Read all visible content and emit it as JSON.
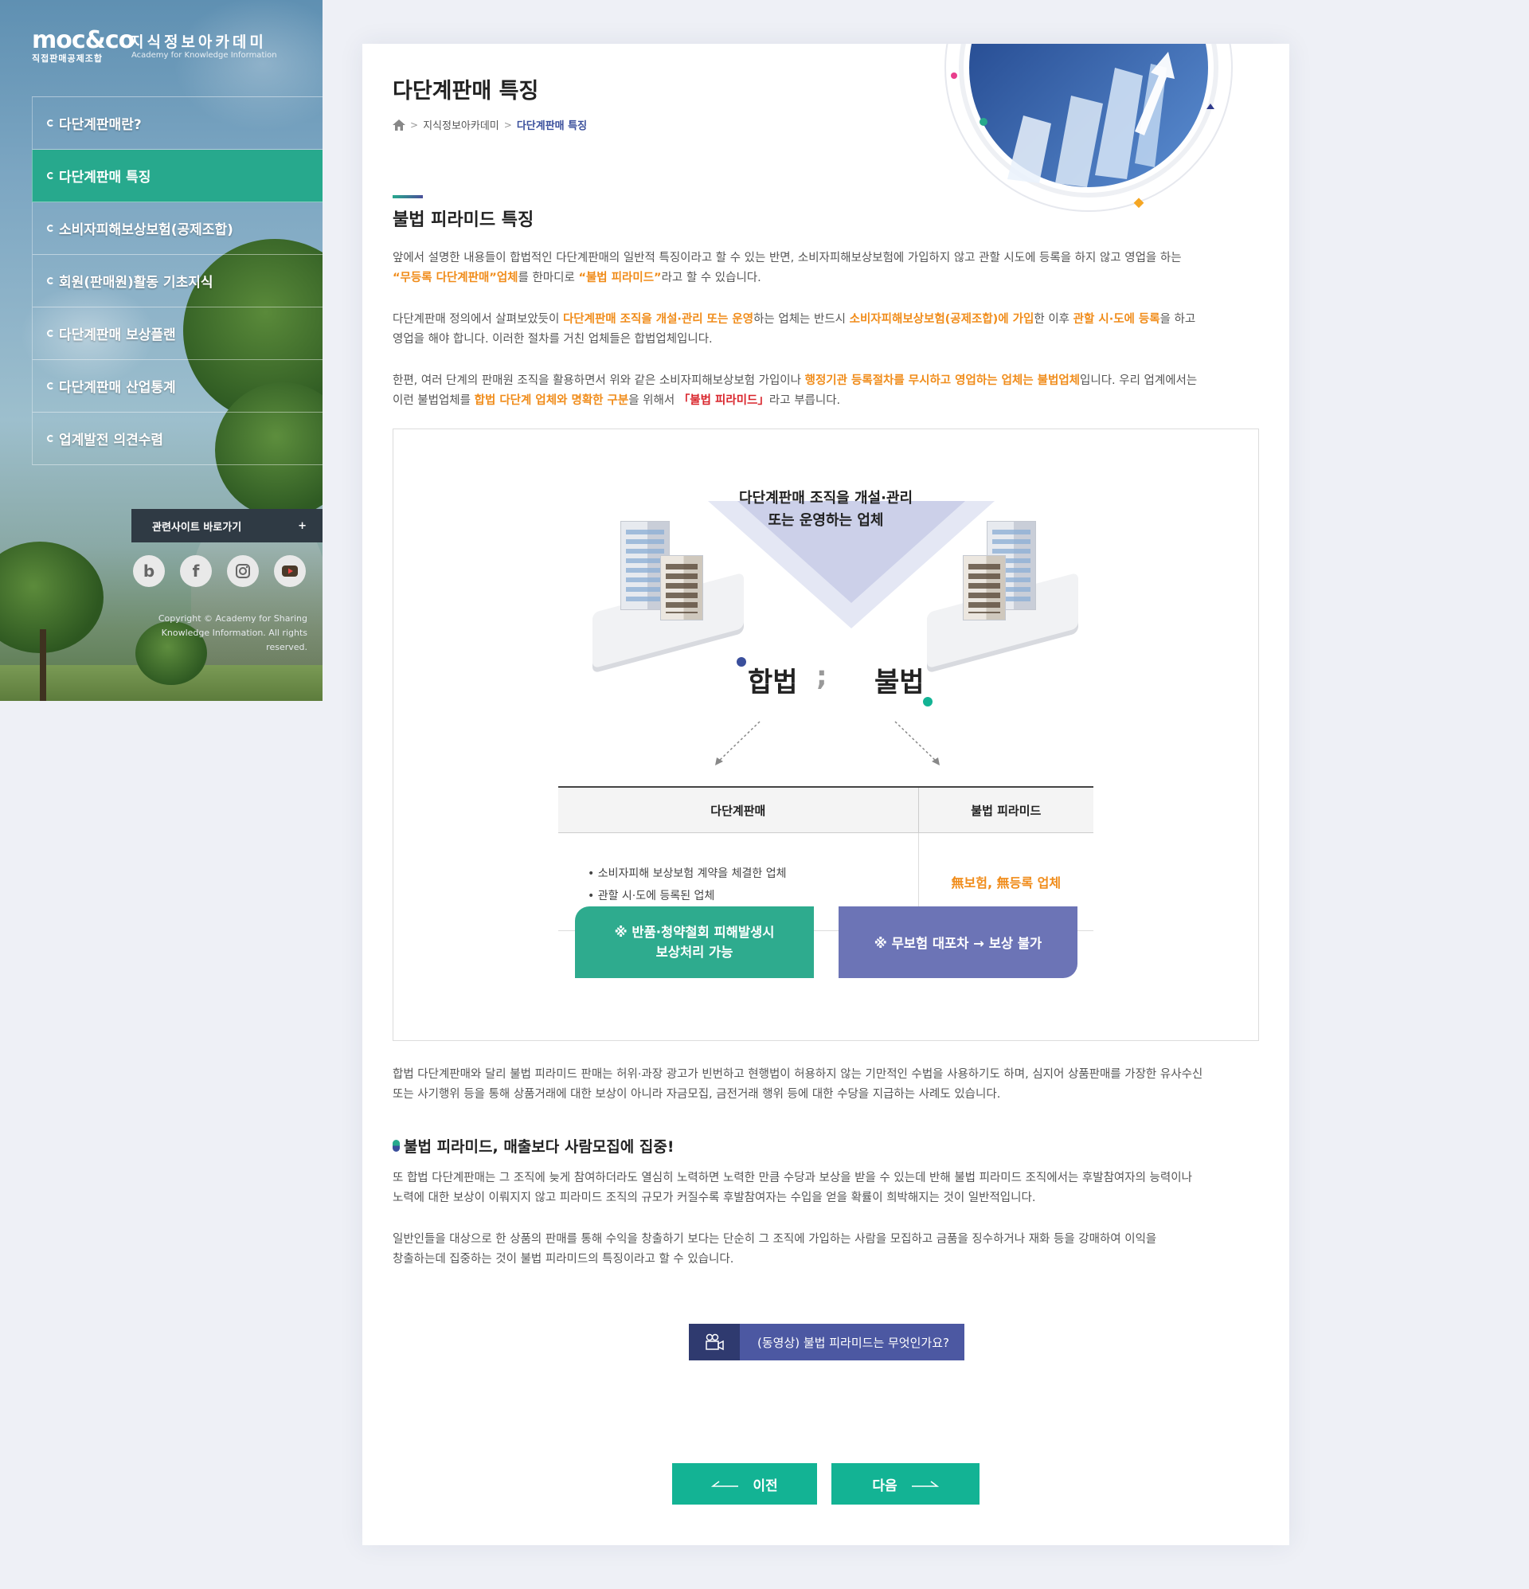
{
  "sidebar": {
    "logo_text": "moc&co",
    "logo_org": "직접판매공제조합",
    "logo_title": "지식정보아카데미",
    "logo_en": "Academy for Knowledge Information",
    "menu": [
      {
        "label": "다단계판매란?"
      },
      {
        "label": "다단계판매 특징",
        "active": true
      },
      {
        "label": "소비자피해보상보험(공제조합)"
      },
      {
        "label": "회원(판매원)활동 기초지식"
      },
      {
        "label": "다단계판매 보상플랜"
      },
      {
        "label": "다단계판매 산업통계"
      },
      {
        "label": "업계발전 의견수렴"
      }
    ],
    "related_label": "관련사이트 바로가기",
    "related_plus": "+",
    "social": [
      {
        "icon": "blog-icon",
        "glyph": "b"
      },
      {
        "icon": "facebook-icon",
        "glyph": "f"
      },
      {
        "icon": "instagram-icon",
        "glyph": ""
      },
      {
        "icon": "youtube-icon",
        "glyph": ""
      }
    ],
    "copyright_line1": "Copyright © Academy for Sharing",
    "copyright_line2": "Knowledge Information. All rights reserved."
  },
  "header": {
    "title": "다단계판매 특징",
    "breadcrumb": [
      "지식정보아카데미",
      "다단계판매 특징"
    ]
  },
  "section": {
    "title": "불법 피라미드 특징",
    "p1": {
      "a": "앞에서 설명한 내용들이 합법적인 다단계판매의 일반적 특징이라고 할 수 있는 반면, 소비자피해보상보험에 가입하지 않고 관할 시도에 등록을 하지 않고 영업을 하는",
      "b": "“무등록 다단계판매”업체",
      "c": "를 한마디로 ",
      "d": "“불법 피라미드”",
      "e": "라고 할 수 있습니다."
    },
    "p2": {
      "a": "다단계판매 정의에서 살펴보았듯이 ",
      "b": "다단계판매 조직을 개설·관리 또는 운영",
      "c": "하는 업체는 반드시 ",
      "d": "소비자피해보상보험(공제조합)에 가입",
      "e": "한 이후 ",
      "f": "관할 시·도에 등록",
      "g": "을 하고",
      "h": "영업을 해야 합니다. 이러한 절차를 거친 업체들은 합법업체입니다."
    },
    "p3": {
      "a": "한편, 여러 단계의 판매원 조직을 활용하면서 위와 같은 소비자피해보상보험 가입이나 ",
      "b": "행정기관 등록절차를 무시하고 영업하는 업체는 불법업체",
      "c": "입니다. 우리 업계에서는",
      "d": "이런 불법업체를 ",
      "e": "합법 다단계 업체와 명확한 구분",
      "f": "을 위해서 ",
      "g": "「불법 피라미드」",
      "h": "라고 부릅니다."
    }
  },
  "diagram": {
    "caption_line1": "다단계판매 조직을 개설·관리",
    "caption_line2": "또는 운영하는 업체",
    "legal_word": "합법",
    "separator": ";",
    "illegal_word": "불법",
    "table": {
      "headers": [
        "다단계판매",
        "불법 피라미드"
      ],
      "legal_items": [
        "소비자피해 보상보험 계약을 체결한 업체",
        "관할 시·도에 등록된 업체"
      ],
      "illegal_text": "無보험, 無등록 업체"
    },
    "legal_note_line1": "※ 반품·청약철회 피해발생시",
    "legal_note_line2": "보상처리 가능",
    "illegal_note": "※ 무보험 대포차 → 보상 불가"
  },
  "after": {
    "p1_line1": "합법 다단계판매와 달리 불법 피라미드 판매는 허위·과장 광고가 빈번하고 현행법이 허용하지 않는 기만적인 수법을 사용하기도 하며, 심지어 상품판매를 가장한 유사수신",
    "p1_line2": "또는 사기행위 등을 통해 상품거래에 대한 보상이 아니라 자금모집, 금전거래 행위 등에 대한 수당을 지급하는 사례도 있습니다.",
    "subtitle": "불법 피라미드, 매출보다 사람모집에 집중!",
    "p2_line1": "또 합법 다단계판매는 그 조직에 늦게 참여하더라도 열심히 노력하면 노력한 만큼 수당과 보상을 받을 수 있는데 반해 불법 피라미드 조직에서는 후발참여자의 능력이나",
    "p2_line2": "노력에 대한 보상이 이뤄지지 않고 피라미드 조직의 규모가 커질수록 후발참여자는 수입을 얻을 확률이 희박해지는 것이 일반적입니다.",
    "p3_line1": "일반인들을 대상으로 한 상품의 판매를 통해 수익을 창출하기 보다는 단순히 그 조직에 가입하는 사람을 모집하고 금품을 징수하거나 재화 등을 강매하여 이익을",
    "p3_line2": "창출하는데 집중하는 것이 불법 피라미드의 특징이라고 할 수 있습니다."
  },
  "video_button": "(동영상) 불법 피라미드는 무엇인가요?",
  "pager": {
    "prev": "이전",
    "next": "다음"
  },
  "colors": {
    "accent_green": "#13b394",
    "accent_navy": "#4c58a2",
    "highlight_orange": "#f08c1a",
    "highlight_red": "#d9252c"
  }
}
